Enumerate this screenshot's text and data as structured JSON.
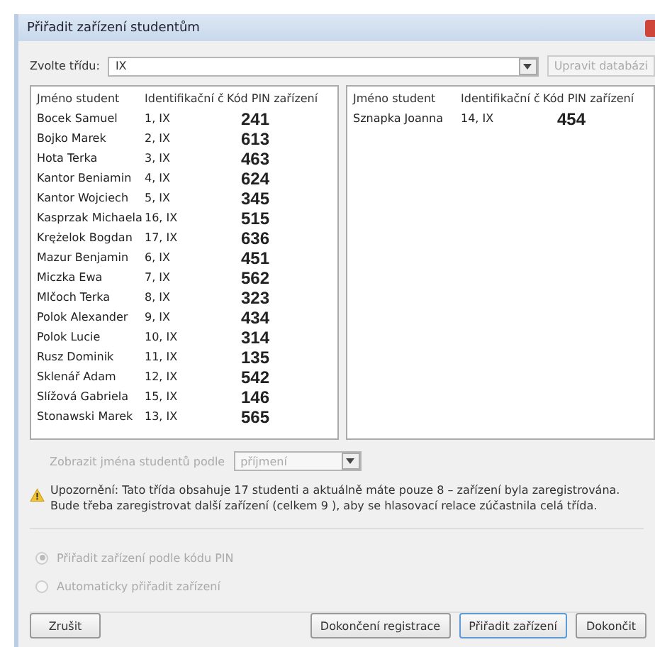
{
  "window": {
    "title": "Přiřadit zařízení studentům"
  },
  "class_select": {
    "label": "Zvolte třídu:",
    "value": "IX",
    "edit_button": {
      "label": "Upravit databázi",
      "disabled": true
    }
  },
  "lists": [
    {
      "columns": [
        "Jméno student",
        "Identifikační č",
        "Kód PIN zařízení"
      ],
      "rows": [
        {
          "name": "Bocek Samuel",
          "id": "1, IX",
          "pin": "241"
        },
        {
          "name": "Bojko Marek",
          "id": "2, IX",
          "pin": "613"
        },
        {
          "name": "Hota Terka",
          "id": "3, IX",
          "pin": "463"
        },
        {
          "name": "Kantor Beniamin",
          "id": "4, IX",
          "pin": "624"
        },
        {
          "name": "Kantor Wojciech",
          "id": "5, IX",
          "pin": "345"
        },
        {
          "name": "Kasprzak Michaela",
          "id": "16, IX",
          "pin": "515"
        },
        {
          "name": "Krężelok Bogdan",
          "id": "17, IX",
          "pin": "636"
        },
        {
          "name": "Mazur Benjamin",
          "id": "6, IX",
          "pin": "451"
        },
        {
          "name": "Miczka Ewa",
          "id": "7, IX",
          "pin": "562"
        },
        {
          "name": "Mlčoch Terka",
          "id": "8, IX",
          "pin": "323"
        },
        {
          "name": "Polok Alexander",
          "id": "9, IX",
          "pin": "434"
        },
        {
          "name": "Polok Lucie",
          "id": "10, IX",
          "pin": "314"
        },
        {
          "name": "Rusz Dominik",
          "id": "11, IX",
          "pin": "135"
        },
        {
          "name": "Sklenář Adam",
          "id": "12, IX",
          "pin": "542"
        },
        {
          "name": "Slížová Gabriela",
          "id": "15, IX",
          "pin": "146"
        },
        {
          "name": "Stonawski Marek",
          "id": "13, IX",
          "pin": "565"
        }
      ]
    },
    {
      "columns": [
        "Jméno student",
        "Identifikační č",
        "Kód PIN zařízení"
      ],
      "rows": [
        {
          "name": "Sznapka Joanna",
          "id": "14, IX",
          "pin": "454"
        }
      ]
    }
  ],
  "name_display": {
    "label": "Zobrazit jména studentů podle",
    "value": "příjmení",
    "disabled": true
  },
  "warning": "Upozornění: Tato třída obsahuje 17 studenti a aktuálně máte pouze 8 – zařízení byla zaregistrována. Bude třeba zaregistrovat další zařízení (celkem 9 ), aby se hlasovací relace zúčastnila celá třída.",
  "assign_options": [
    {
      "label": "Přiřadit zařízení podle kódu PIN",
      "selected": true,
      "disabled": true
    },
    {
      "label": "Automaticky přiřadit zařízení",
      "selected": false,
      "disabled": true
    }
  ],
  "buttons": [
    {
      "label": "Zrušit",
      "focused": false
    },
    {
      "label": "Dokončení registrace",
      "focused": false
    },
    {
      "label": "Přiřadit zařízení",
      "focused": true
    },
    {
      "label": "Dokončit",
      "focused": false
    }
  ]
}
